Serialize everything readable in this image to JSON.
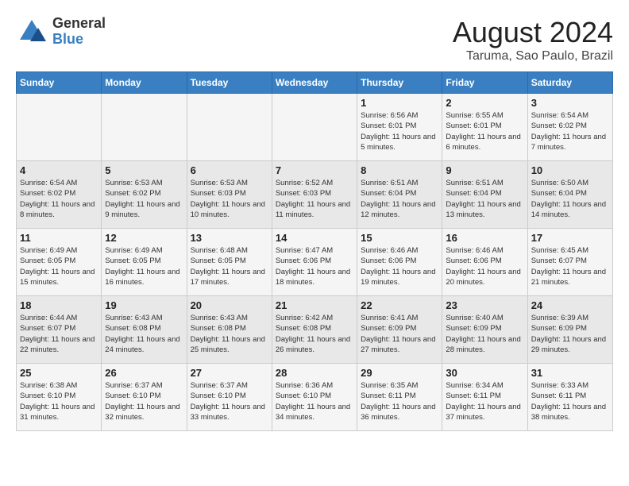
{
  "header": {
    "logo_general": "General",
    "logo_blue": "Blue",
    "main_title": "August 2024",
    "subtitle": "Taruma, Sao Paulo, Brazil"
  },
  "days_of_week": [
    "Sunday",
    "Monday",
    "Tuesday",
    "Wednesday",
    "Thursday",
    "Friday",
    "Saturday"
  ],
  "weeks": [
    [
      {
        "day": "",
        "info": ""
      },
      {
        "day": "",
        "info": ""
      },
      {
        "day": "",
        "info": ""
      },
      {
        "day": "",
        "info": ""
      },
      {
        "day": "1",
        "info": "Sunrise: 6:56 AM\nSunset: 6:01 PM\nDaylight: 11 hours\nand 5 minutes."
      },
      {
        "day": "2",
        "info": "Sunrise: 6:55 AM\nSunset: 6:01 PM\nDaylight: 11 hours\nand 6 minutes."
      },
      {
        "day": "3",
        "info": "Sunrise: 6:54 AM\nSunset: 6:02 PM\nDaylight: 11 hours\nand 7 minutes."
      }
    ],
    [
      {
        "day": "4",
        "info": "Sunrise: 6:54 AM\nSunset: 6:02 PM\nDaylight: 11 hours\nand 8 minutes."
      },
      {
        "day": "5",
        "info": "Sunrise: 6:53 AM\nSunset: 6:02 PM\nDaylight: 11 hours\nand 9 minutes."
      },
      {
        "day": "6",
        "info": "Sunrise: 6:53 AM\nSunset: 6:03 PM\nDaylight: 11 hours\nand 10 minutes."
      },
      {
        "day": "7",
        "info": "Sunrise: 6:52 AM\nSunset: 6:03 PM\nDaylight: 11 hours\nand 11 minutes."
      },
      {
        "day": "8",
        "info": "Sunrise: 6:51 AM\nSunset: 6:04 PM\nDaylight: 11 hours\nand 12 minutes."
      },
      {
        "day": "9",
        "info": "Sunrise: 6:51 AM\nSunset: 6:04 PM\nDaylight: 11 hours\nand 13 minutes."
      },
      {
        "day": "10",
        "info": "Sunrise: 6:50 AM\nSunset: 6:04 PM\nDaylight: 11 hours\nand 14 minutes."
      }
    ],
    [
      {
        "day": "11",
        "info": "Sunrise: 6:49 AM\nSunset: 6:05 PM\nDaylight: 11 hours\nand 15 minutes."
      },
      {
        "day": "12",
        "info": "Sunrise: 6:49 AM\nSunset: 6:05 PM\nDaylight: 11 hours\nand 16 minutes."
      },
      {
        "day": "13",
        "info": "Sunrise: 6:48 AM\nSunset: 6:05 PM\nDaylight: 11 hours\nand 17 minutes."
      },
      {
        "day": "14",
        "info": "Sunrise: 6:47 AM\nSunset: 6:06 PM\nDaylight: 11 hours\nand 18 minutes."
      },
      {
        "day": "15",
        "info": "Sunrise: 6:46 AM\nSunset: 6:06 PM\nDaylight: 11 hours\nand 19 minutes."
      },
      {
        "day": "16",
        "info": "Sunrise: 6:46 AM\nSunset: 6:06 PM\nDaylight: 11 hours\nand 20 minutes."
      },
      {
        "day": "17",
        "info": "Sunrise: 6:45 AM\nSunset: 6:07 PM\nDaylight: 11 hours\nand 21 minutes."
      }
    ],
    [
      {
        "day": "18",
        "info": "Sunrise: 6:44 AM\nSunset: 6:07 PM\nDaylight: 11 hours\nand 22 minutes."
      },
      {
        "day": "19",
        "info": "Sunrise: 6:43 AM\nSunset: 6:08 PM\nDaylight: 11 hours\nand 24 minutes."
      },
      {
        "day": "20",
        "info": "Sunrise: 6:43 AM\nSunset: 6:08 PM\nDaylight: 11 hours\nand 25 minutes."
      },
      {
        "day": "21",
        "info": "Sunrise: 6:42 AM\nSunset: 6:08 PM\nDaylight: 11 hours\nand 26 minutes."
      },
      {
        "day": "22",
        "info": "Sunrise: 6:41 AM\nSunset: 6:09 PM\nDaylight: 11 hours\nand 27 minutes."
      },
      {
        "day": "23",
        "info": "Sunrise: 6:40 AM\nSunset: 6:09 PM\nDaylight: 11 hours\nand 28 minutes."
      },
      {
        "day": "24",
        "info": "Sunrise: 6:39 AM\nSunset: 6:09 PM\nDaylight: 11 hours\nand 29 minutes."
      }
    ],
    [
      {
        "day": "25",
        "info": "Sunrise: 6:38 AM\nSunset: 6:10 PM\nDaylight: 11 hours\nand 31 minutes."
      },
      {
        "day": "26",
        "info": "Sunrise: 6:37 AM\nSunset: 6:10 PM\nDaylight: 11 hours\nand 32 minutes."
      },
      {
        "day": "27",
        "info": "Sunrise: 6:37 AM\nSunset: 6:10 PM\nDaylight: 11 hours\nand 33 minutes."
      },
      {
        "day": "28",
        "info": "Sunrise: 6:36 AM\nSunset: 6:10 PM\nDaylight: 11 hours\nand 34 minutes."
      },
      {
        "day": "29",
        "info": "Sunrise: 6:35 AM\nSunset: 6:11 PM\nDaylight: 11 hours\nand 36 minutes."
      },
      {
        "day": "30",
        "info": "Sunrise: 6:34 AM\nSunset: 6:11 PM\nDaylight: 11 hours\nand 37 minutes."
      },
      {
        "day": "31",
        "info": "Sunrise: 6:33 AM\nSunset: 6:11 PM\nDaylight: 11 hours\nand 38 minutes."
      }
    ]
  ]
}
